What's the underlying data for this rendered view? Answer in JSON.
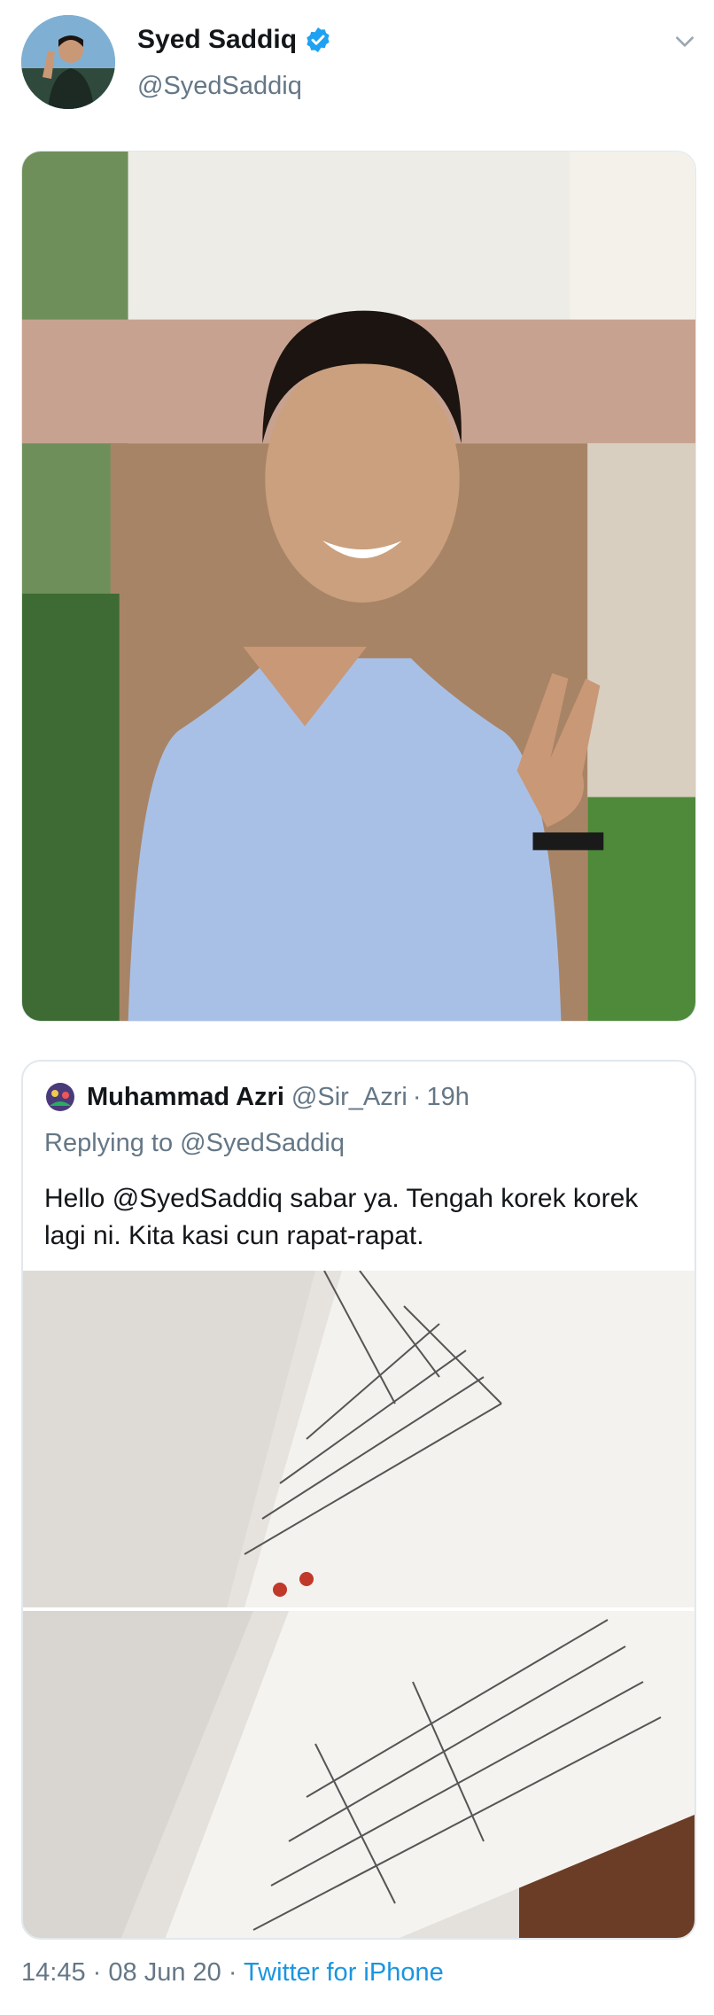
{
  "author": {
    "display_name": "Syed Saddiq",
    "handle": "@SyedSaddiq",
    "verified": true,
    "icons": {
      "verified": "verified-badge-icon",
      "caret": "chevron-down-icon"
    }
  },
  "quoted_tweet": {
    "display_name": "Muhammad Azri",
    "handle": "@Sir_Azri",
    "separator": "·",
    "time": "19h",
    "replying_prefix": "Replying to",
    "replying_to": "@SyedSaddiq",
    "text": "Hello @SyedSaddiq sabar ya. Tengah korek korek lagi ni. Kita kasi cun rapat-rapat."
  },
  "footer": {
    "time": "14:45",
    "separator": "·",
    "date": "08 Jun 20",
    "source": "Twitter for iPhone"
  },
  "colors": {
    "link": "#1b95e0",
    "secondary_text": "#657786",
    "primary_text": "#14171a",
    "verified": "#1da1f2"
  }
}
